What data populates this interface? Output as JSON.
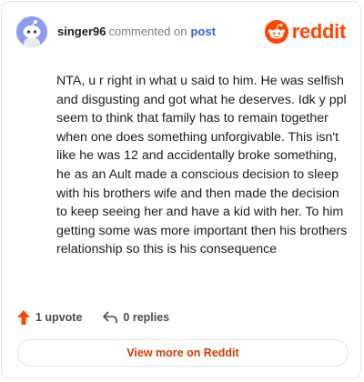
{
  "header": {
    "username": "singer96",
    "action_text": "commented on",
    "post_link": "post",
    "brand_name": "reddit",
    "avatar_icon": "snoo-avatar-icon",
    "brand_icon": "reddit-logo-icon"
  },
  "comment": {
    "body": "NTA, u r right in what u said to him. He was selfish and disgusting and got what he deserves. Idk y ppl seem to think that family has to remain together when one does something unforgivable. This isn't like he was 12 and accidentally broke something, he as an Ault made a conscious decision to sleep with his brothers wife and then made the decision to keep seeing her and have a kid with her. To him getting some was more important then his brothers relationship so this is his consequence"
  },
  "actions": {
    "upvote_label": "1 upvote",
    "replies_label": "0 replies",
    "upvote_icon": "upvote-arrow-icon",
    "reply_icon": "reply-arrow-icon"
  },
  "footer": {
    "view_more_label": "View more on Reddit"
  },
  "colors": {
    "accent": "#ff4500",
    "link": "#3a5fcd",
    "avatar_bg": "#8c9cf0",
    "view_more_text": "#d93a00"
  }
}
